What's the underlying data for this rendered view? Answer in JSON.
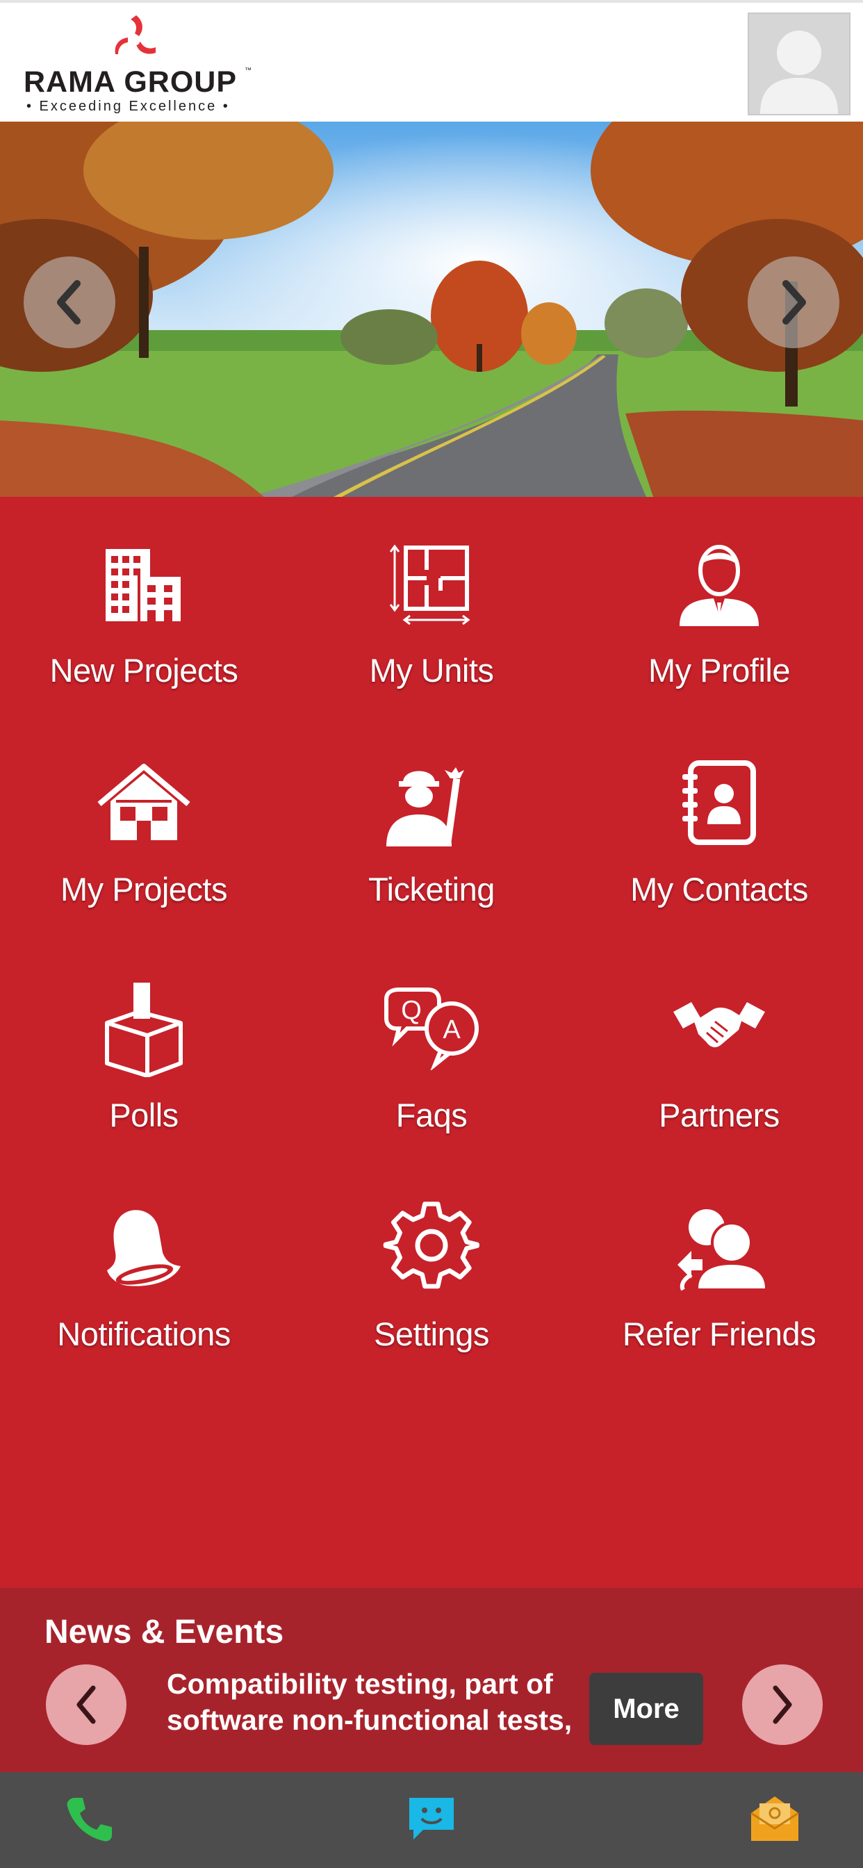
{
  "header": {
    "brand_name": "RAMA GROUP",
    "brand_tm": "™",
    "tagline": "• Exceeding Excellence •",
    "avatar_icon": "user-placeholder-icon"
  },
  "banner": {
    "prev_icon": "chevron-left-icon",
    "next_icon": "chevron-right-icon"
  },
  "menu": {
    "items": [
      {
        "label": "New Projects",
        "icon": "buildings-icon"
      },
      {
        "label": "My Units",
        "icon": "floor-plan-icon"
      },
      {
        "label": "My Profile",
        "icon": "person-icon"
      },
      {
        "label": "My Projects",
        "icon": "house-icon"
      },
      {
        "label": "Ticketing",
        "icon": "worker-wrench-icon"
      },
      {
        "label": "My Contacts",
        "icon": "address-book-icon"
      },
      {
        "label": "Polls",
        "icon": "ballot-box-icon"
      },
      {
        "label": "Faqs",
        "icon": "qa-bubbles-icon"
      },
      {
        "label": "Partners",
        "icon": "handshake-icon"
      },
      {
        "label": "Notifications",
        "icon": "bell-icon"
      },
      {
        "label": "Settings",
        "icon": "gear-icon"
      },
      {
        "label": "Refer Friends",
        "icon": "refer-users-icon"
      }
    ]
  },
  "news": {
    "title": "News & Events",
    "text_line1": "Compatibility testing, part of",
    "text_line2": "software non-functional tests,",
    "more_label": "More"
  },
  "bottom_bar": {
    "call_icon": "phone-icon",
    "chat_icon": "chat-icon",
    "mail_icon": "mail-icon"
  },
  "colors": {
    "primary_red": "#c7212a",
    "news_red": "#a7232c",
    "bottom_bar": "#4d4d4d",
    "phone_green": "#2fbf4f",
    "chat_blue": "#19b8e6",
    "mail_orange": "#f0a21e"
  }
}
